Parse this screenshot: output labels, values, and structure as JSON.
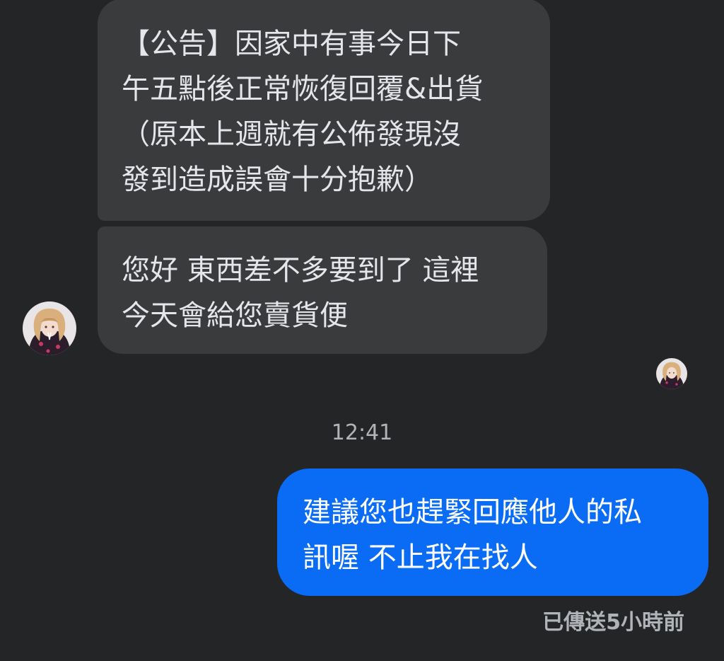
{
  "conversation": {
    "incoming_messages": [
      {
        "text": "【公告】因家中有事今日下\n午五點後正常恢復回覆&出貨\n（原本上週就有公佈發現沒\n發到造成誤會十分抱歉）"
      },
      {
        "text": "您好 東西差不多要到了 這裡\n今天會給您賣貨便"
      }
    ],
    "timestamp": "12:41",
    "outgoing_messages": [
      {
        "text": "建議您也趕緊回應他人的私\n訊喔 不止我在找人"
      }
    ],
    "delivery_status": "已傳送5小時前",
    "avatar_icon": "contact-avatar-icon",
    "seen_icon": "seen-avatar-icon"
  },
  "colors": {
    "background": "#242526",
    "incoming_bubble": "#3a3b3c",
    "outgoing_bubble": "#0a6cf5",
    "text_primary": "#e4e6eb",
    "text_secondary": "#b0b3b8"
  }
}
